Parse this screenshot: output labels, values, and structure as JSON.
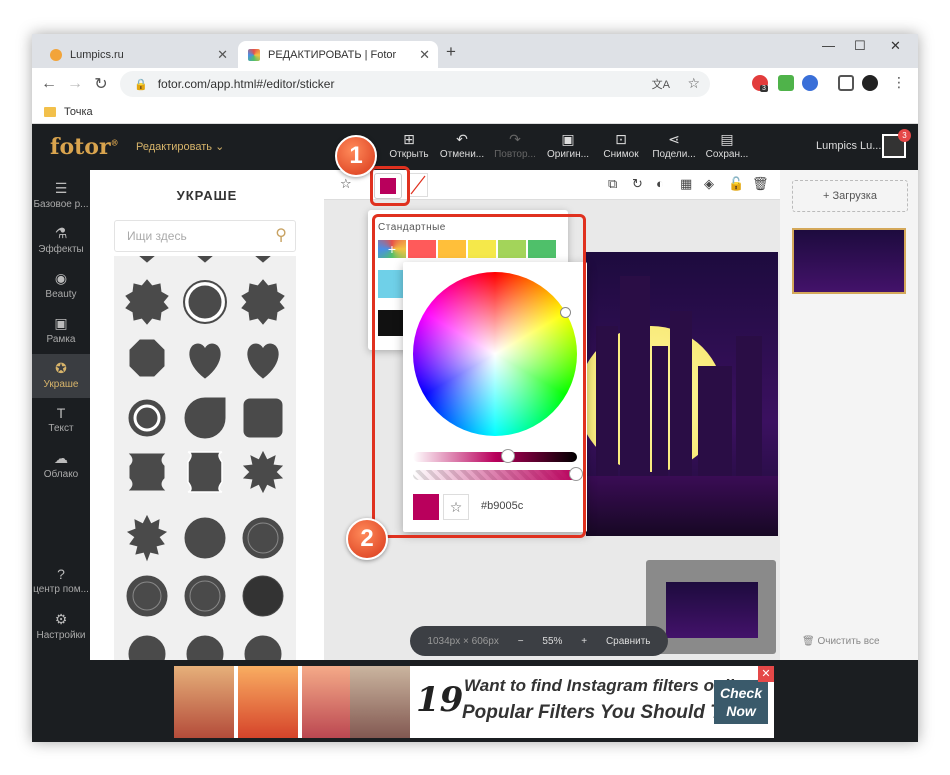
{
  "browser": {
    "tabs": [
      {
        "title": "Lumpics.ru",
        "favicon_color": "#f2a43a"
      },
      {
        "title": "РЕДАКТИРОВАТЬ | Fotor",
        "favicon_color": "#e6504a"
      }
    ],
    "url": "fotor.com/app.html#/editor/sticker",
    "bookmark": "Точка",
    "extension_badge": "3"
  },
  "app": {
    "logo": "fotor",
    "logo_mark": "®",
    "edit_menu": "Редактировать",
    "toolbar": [
      {
        "label": "Открыть",
        "icon": "open-icon"
      },
      {
        "label": "Отмени...",
        "icon": "undo-icon"
      },
      {
        "label": "Повтор...",
        "icon": "redo-icon",
        "disabled": true
      },
      {
        "label": "Оригин...",
        "icon": "original-icon"
      },
      {
        "label": "Снимок",
        "icon": "snapshot-icon"
      },
      {
        "label": "Подели...",
        "icon": "share-icon"
      },
      {
        "label": "Сохран...",
        "icon": "save-icon"
      }
    ],
    "user": "Lumpics Lu...",
    "notification_count": "3"
  },
  "leftnav": [
    {
      "label": "Базовое р...",
      "icon": "sliders-icon"
    },
    {
      "label": "Эффекты",
      "icon": "flask-icon"
    },
    {
      "label": "Beauty",
      "icon": "eye-icon"
    },
    {
      "label": "Рамка",
      "icon": "frame-icon"
    },
    {
      "label": "Украше",
      "icon": "sticker-icon",
      "active": true
    },
    {
      "label": "Текст",
      "icon": "text-icon"
    },
    {
      "label": "Облако",
      "icon": "cloud-icon"
    },
    {
      "label": "центр пом...",
      "icon": "help-icon"
    },
    {
      "label": "Настройки",
      "icon": "settings-icon"
    }
  ],
  "panel": {
    "title": "УКРАШЕ",
    "search_placeholder": "Ищи здесь"
  },
  "editor": {
    "selected_color": "#b9005c",
    "zoom": {
      "dimensions": "1034px × 606px",
      "minus": "−",
      "value": "55%",
      "plus": "+",
      "compare": "Сравнить"
    }
  },
  "color_picker": {
    "section_label": "Стандартные",
    "standard_colors": [
      "#ff5a5a",
      "#ffbf3a",
      "#f5e84a",
      "#a3d45a",
      "#4fc06a",
      "#6fd0e8",
      "#111111"
    ],
    "hex": "#b9005c",
    "hue_position": 0.55,
    "alpha": 1.0
  },
  "right_panel": {
    "upload_label": "Загрузка",
    "clear_label": "Очистить все"
  },
  "ad": {
    "number": "19",
    "line1": "Want to find Instagram filters online?",
    "line2": "Popular Filters You Should Try",
    "cta": "Check Now",
    "close": "✕"
  },
  "annotations": [
    {
      "number": "1"
    },
    {
      "number": "2"
    }
  ]
}
